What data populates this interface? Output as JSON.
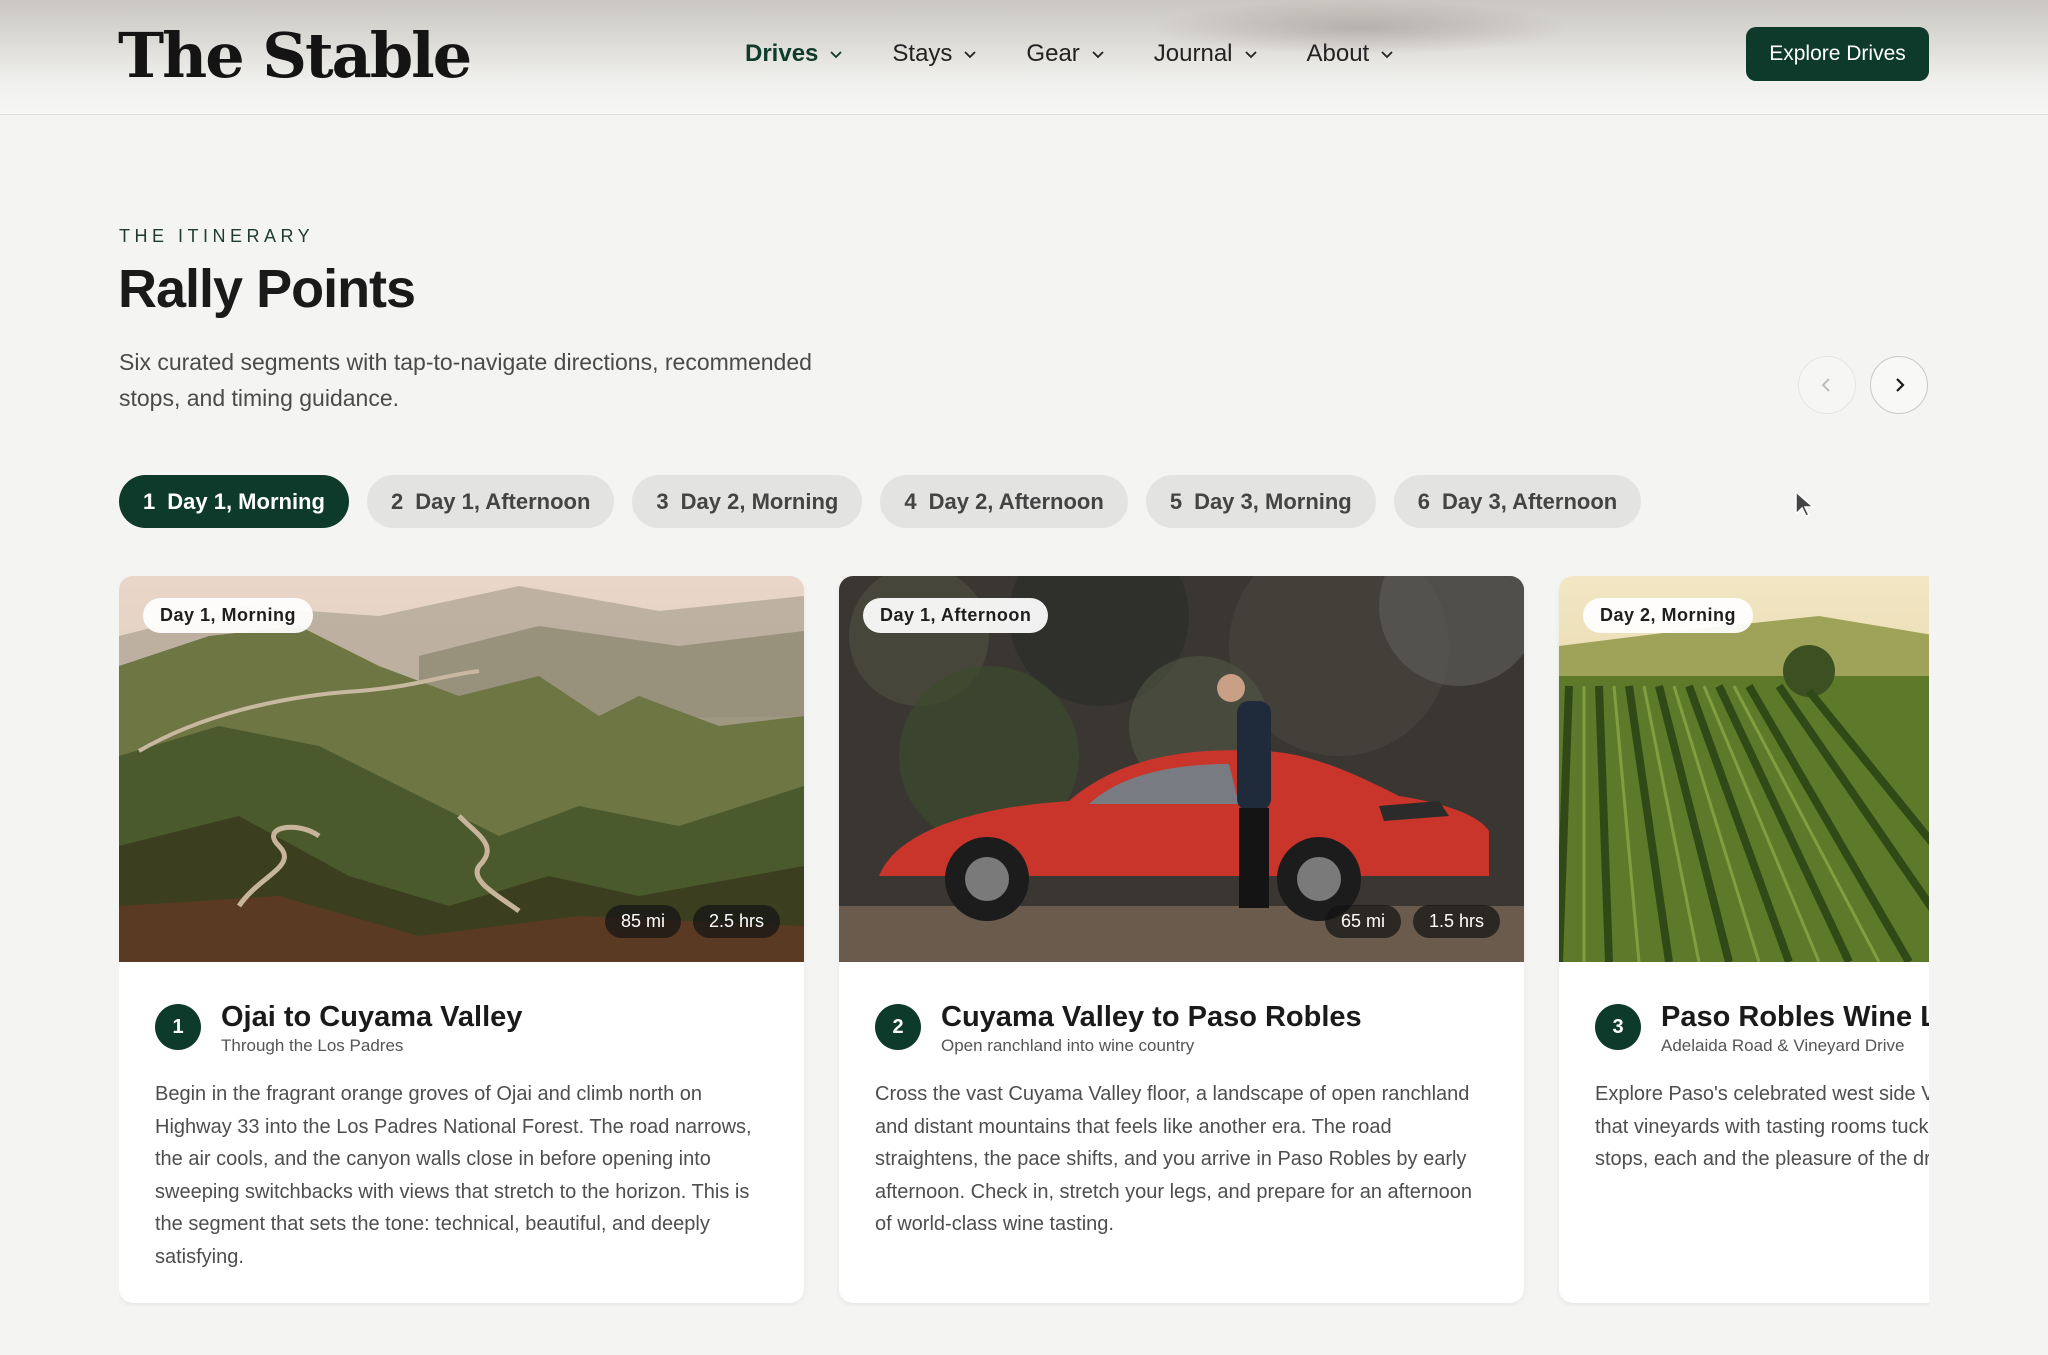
{
  "header": {
    "logo": "The Stable",
    "nav": [
      {
        "label": "Drives",
        "active": true
      },
      {
        "label": "Stays",
        "active": false
      },
      {
        "label": "Gear",
        "active": false
      },
      {
        "label": "Journal",
        "active": false
      },
      {
        "label": "About",
        "active": false
      }
    ],
    "cta": "Explore Drives"
  },
  "intro": {
    "eyebrow": "THE ITINERARY",
    "title": "Rally Points",
    "subtitle": "Six curated segments with tap-to-navigate directions, recommended stops, and timing guidance."
  },
  "tabs": [
    {
      "num": "1",
      "label": "Day 1, Morning",
      "active": true
    },
    {
      "num": "2",
      "label": "Day 1, Afternoon",
      "active": false
    },
    {
      "num": "3",
      "label": "Day 2, Morning",
      "active": false
    },
    {
      "num": "4",
      "label": "Day 2, Afternoon",
      "active": false
    },
    {
      "num": "5",
      "label": "Day 3, Morning",
      "active": false
    },
    {
      "num": "6",
      "label": "Day 3, Afternoon",
      "active": false
    }
  ],
  "cards": [
    {
      "badge": "Day 1, Morning",
      "distance": "85 mi",
      "duration": "2.5 hrs",
      "num": "1",
      "title": "Ojai to Cuyama Valley",
      "subtitle": "Through the Los Padres",
      "description": "Begin in the fragrant orange groves of Ojai and climb north on Highway 33 into the Los Padres National Forest. The road narrows, the air cools, and the canyon walls close in before opening into sweeping switchbacks with views that stretch to the horizon. This is the segment that sets the tone: technical, beautiful, and deeply satisfying."
    },
    {
      "badge": "Day 1, Afternoon",
      "distance": "65 mi",
      "duration": "1.5 hrs",
      "num": "2",
      "title": "Cuyama Valley to Paso Robles",
      "subtitle": "Open ranchland into wine country",
      "description": "Cross the vast Cuyama Valley floor, a landscape of open ranchland and distant mountains that feels like another era. The road straightens, the pace shifts, and you arrive in Paso Robles by early afternoon. Check in, stretch your legs, and prepare for an afternoon of world-class wine tasting."
    },
    {
      "badge": "Day 2, Morning",
      "num": "3",
      "title": "Paso Robles Wine Lo",
      "subtitle": "Adelaida Road & Vineyard Drive",
      "description": "Explore Paso's celebrated west side Vineyard Drive, quiet backroads that vineyards with tasting rooms tucked recommend three to four stops, each and the pleasure of the drive betwee"
    }
  ],
  "colors": {
    "accent": "#0d3a2b",
    "tab_inactive": "#e3e3e1",
    "page_bg": "#f4f4f3"
  }
}
